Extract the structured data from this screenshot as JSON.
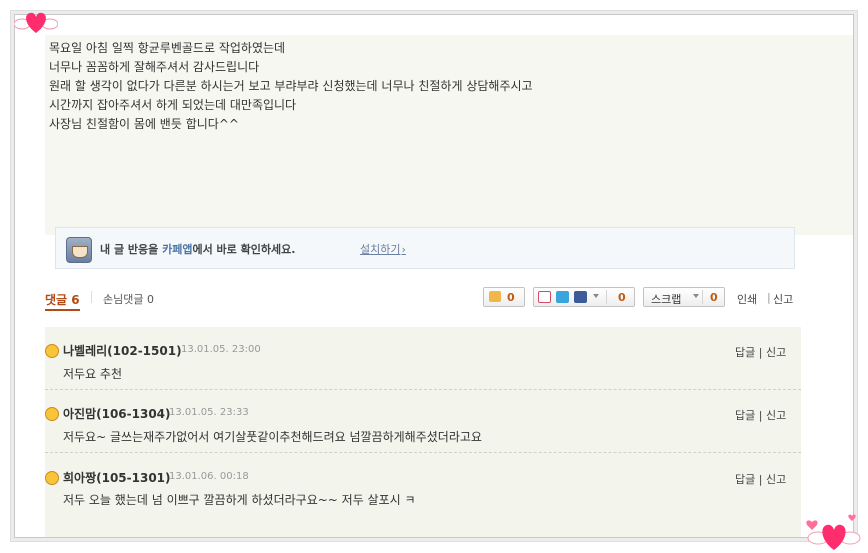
{
  "post": {
    "lines": [
      "목요일 아침 일찍 항균루벤골드로 작업하였는데",
      "너무나 꼼꼼하게 잘해주셔서 감사드립니다",
      "원래 할 생각이 없다가 다른분 하시는거 보고 부랴부랴 신청했는데 너무나 친절하게 상담해주시고",
      "시간까지 잡아주셔서 하게 되었는데 대만족입니다",
      "사장님 친절함이 몸에 밴듯 합니다^^"
    ]
  },
  "cafe_app": {
    "prefix": "내 글 반응을 ",
    "app": "카페앱",
    "suffix": "에서 바로 확인하세요.",
    "install": "설치하기",
    "install_arrow": "›"
  },
  "toolbar": {
    "reply_tab": "댓글 6",
    "guest_reply": "손님댓글 0",
    "like_count": "0",
    "share_count": "0",
    "scrap_label": "스크랩",
    "scrap_count": "0",
    "print": "인쇄",
    "report": "신고"
  },
  "comments": [
    {
      "name": "나벨레리(102-1501)",
      "date": "13.01.05. 23:00",
      "body": "저두요 추천",
      "reply": "답글",
      "report": "신고"
    },
    {
      "name": "아진맘(106-1304)",
      "date": "13.01.05. 23:33",
      "body": "저두요~ 글쓰는재주가없어서 여기살풋같이추천해드려요 넘깔끔하게해주셨더라고요",
      "reply": "답글",
      "report": "신고"
    },
    {
      "name": "희아짱(105-1301)",
      "date": "13.01.06. 00:18",
      "body": "저두 오늘 했는데 넘 이쁘구 깔끔하게 하셨더라구요~~ 저두 살포시 ㅋ",
      "reply": "답글",
      "report": "신고"
    }
  ],
  "colors": {
    "accent": "#b14a14",
    "post_bg": "#f7f7f2",
    "comment_bg": "#f3f5ec",
    "heart": "#ff2d6e"
  }
}
